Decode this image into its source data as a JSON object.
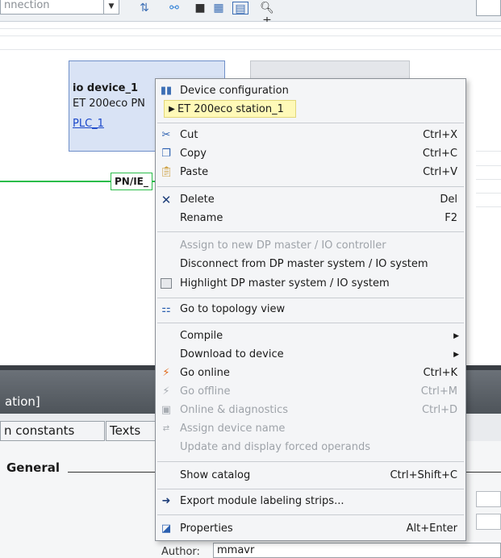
{
  "toolbar": {
    "connection_combo_text": "nnection",
    "icons": [
      "topology-icon",
      "network-icon",
      "device-icon",
      "table-icon",
      "overview-icon",
      "zoom-icon"
    ]
  },
  "canvas": {
    "device": {
      "name": "io device_1",
      "type": "ET 200eco PN",
      "controller_link": "PLC_1"
    },
    "network_label": "PN/IE_"
  },
  "context_menu": {
    "header": {
      "device_configuration": "Device configuration",
      "station": "ET 200eco station_1"
    },
    "groups": [
      [
        {
          "label": "Cut",
          "shortcut": "Ctrl+X",
          "icon": "scissors-icon"
        },
        {
          "label": "Copy",
          "shortcut": "Ctrl+C",
          "icon": "copy-icon"
        },
        {
          "label": "Paste",
          "shortcut": "Ctrl+V",
          "icon": "paste-icon"
        }
      ],
      [
        {
          "label": "Delete",
          "shortcut": "Del",
          "icon": "delete-icon"
        },
        {
          "label": "Rename",
          "shortcut": "F2"
        }
      ],
      [
        {
          "label": "Assign to new DP master / IO controller",
          "disabled": true
        },
        {
          "label": "Disconnect from DP master system / IO system"
        },
        {
          "label": "Highlight DP master system / IO system",
          "icon": "checkbox-icon"
        }
      ],
      [
        {
          "label": "Go to topology view",
          "icon": "topology-icon"
        }
      ],
      [
        {
          "label": "Compile",
          "submenu": true
        },
        {
          "label": "Download to device",
          "submenu": true
        },
        {
          "label": "Go online",
          "shortcut": "Ctrl+K",
          "icon": "go-online-icon"
        },
        {
          "label": "Go offline",
          "shortcut": "Ctrl+M",
          "icon": "go-offline-icon",
          "disabled": true
        },
        {
          "label": "Online & diagnostics",
          "shortcut": "Ctrl+D",
          "icon": "diagnostics-icon",
          "disabled": true
        },
        {
          "label": "Assign device name",
          "icon": "assign-name-icon",
          "disabled": true
        },
        {
          "label": "Update and display forced operands",
          "disabled": true
        }
      ],
      [
        {
          "label": "Show catalog",
          "shortcut": "Ctrl+Shift+C"
        }
      ],
      [
        {
          "label": "Export module labeling strips...",
          "icon": "export-arrow-icon"
        }
      ],
      [
        {
          "label": "Properties",
          "shortcut": "Alt+Enter",
          "icon": "properties-icon"
        }
      ]
    ]
  },
  "inspector": {
    "title": "ation]",
    "tabs": [
      "n constants",
      "Texts"
    ],
    "section": "General",
    "author_label": "Author:",
    "author_value": "mmavr"
  },
  "colors": {
    "device_fill": "#d9e3f5",
    "network_green": "#2bbd4a",
    "highlight_yellow": "#fff9b8",
    "panel_dark": "#4e545a"
  }
}
